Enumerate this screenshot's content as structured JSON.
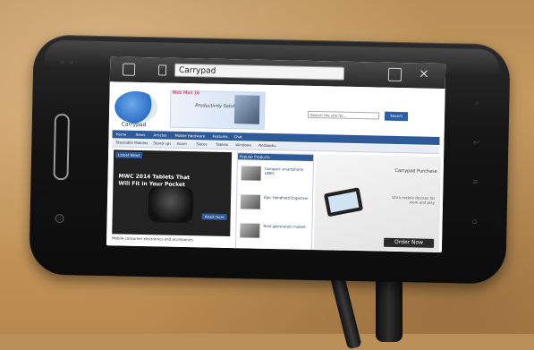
{
  "browser": {
    "url": "Carrypad",
    "close": "×"
  },
  "site": {
    "logo_text": "Carrypad",
    "banner_tag": "Web Mail 16",
    "banner_text": "Productivity Solution",
    "search_placeholder": "Search the site for...",
    "search_button": "Search",
    "nav": [
      "Home",
      "News",
      "Articles",
      "Mobile Hardware",
      "Features",
      "Chat"
    ],
    "subnav": [
      "Stackable Mobiles",
      "Stand ups",
      "Xoom",
      "Slates",
      "Tablets",
      "Windows",
      "Netbooks"
    ],
    "feature_tag": "Latest News",
    "feature_title": "MWC 2014 Tablets That Will Fit in Your Pocket",
    "feature_more": "Read more",
    "feature_caption": "Mobile consumer electronics and accessories",
    "mid_head": "Popular Products",
    "mid_items": [
      "Compact smartphone UMPC",
      "Epic Handheld Organizer",
      "Next generation mobile"
    ],
    "ad_title": "Carrypad Purchase",
    "ad_sub": "Ultra mobile devices for work and play",
    "order_button": "Order Now"
  }
}
